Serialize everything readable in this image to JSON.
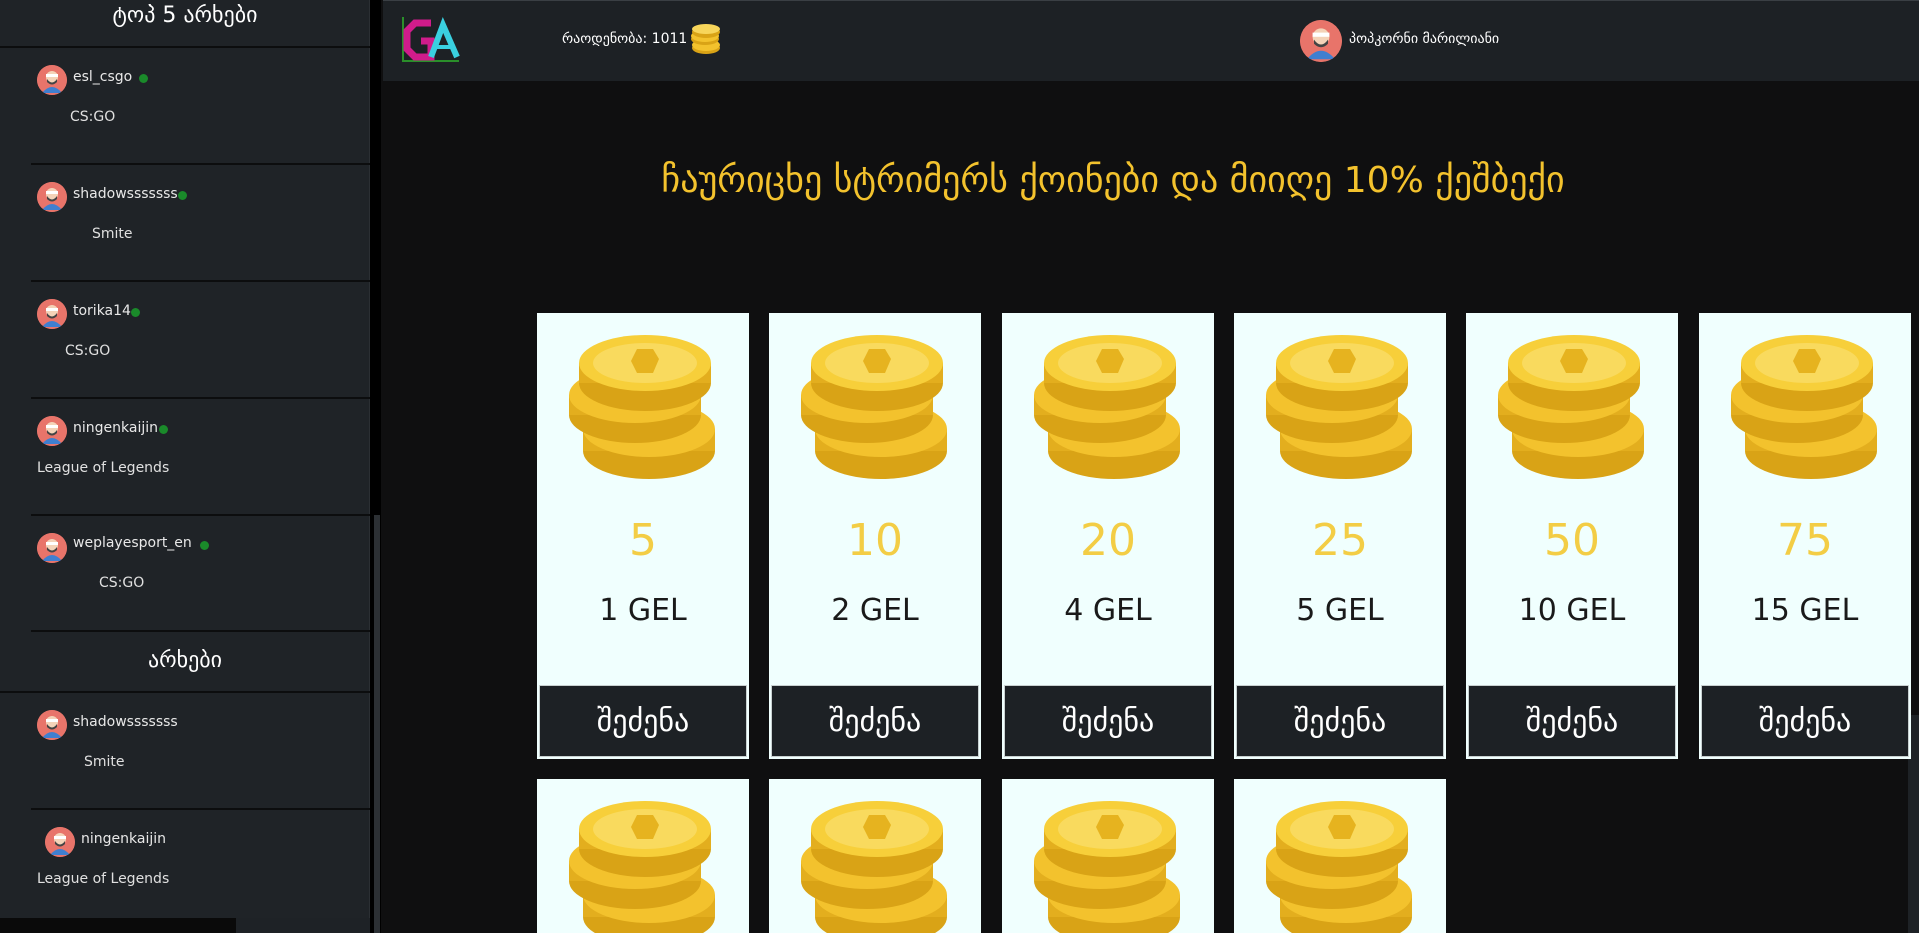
{
  "sidebar": {
    "top_title": "ტოპ 5 არხები",
    "top_streamers": [
      {
        "name": "esl_csgo",
        "game": "CS:GO"
      },
      {
        "name": "shadowsssssss",
        "game": "Smite"
      },
      {
        "name": "torika14",
        "game": "CS:GO"
      },
      {
        "name": "ningenkaijin",
        "game": "League of Legends"
      },
      {
        "name": "weplayesport_en",
        "game": "CS:GO"
      }
    ],
    "channels_title": "არხები",
    "channels": [
      {
        "name": "shadowsssssss",
        "game": "Smite"
      },
      {
        "name": "ningenkaijin",
        "game": "League of Legends"
      }
    ]
  },
  "header": {
    "logo_text": "GA",
    "ranking": "რაოდენობა: 1011",
    "user_name": "პოპკორნი მარილიანი",
    "coin_icon": "coin-stack-icon"
  },
  "main": {
    "headline": "ჩაურიცხე სტრიმერს ქოინები და მიიღე 10% ქეშბექი",
    "packages": [
      {
        "amount": "5",
        "price": "1 GEL",
        "button": "შეძენა"
      },
      {
        "amount": "10",
        "price": "2 GEL",
        "button": "შეძენა"
      },
      {
        "amount": "20",
        "price": "4 GEL",
        "button": "შეძენა"
      },
      {
        "amount": "25",
        "price": "5 GEL",
        "button": "შეძენა"
      },
      {
        "amount": "50",
        "price": "10 GEL",
        "button": "შეძენა"
      },
      {
        "amount": "75",
        "price": "15 GEL",
        "button": "შეძენა"
      }
    ],
    "second_row_count_visible": 4
  },
  "colors": {
    "accent": "#f3c22d",
    "sidebar_bg": "#1f2327",
    "card_bg": "#f0fffe",
    "online": "#1a8a2a"
  }
}
